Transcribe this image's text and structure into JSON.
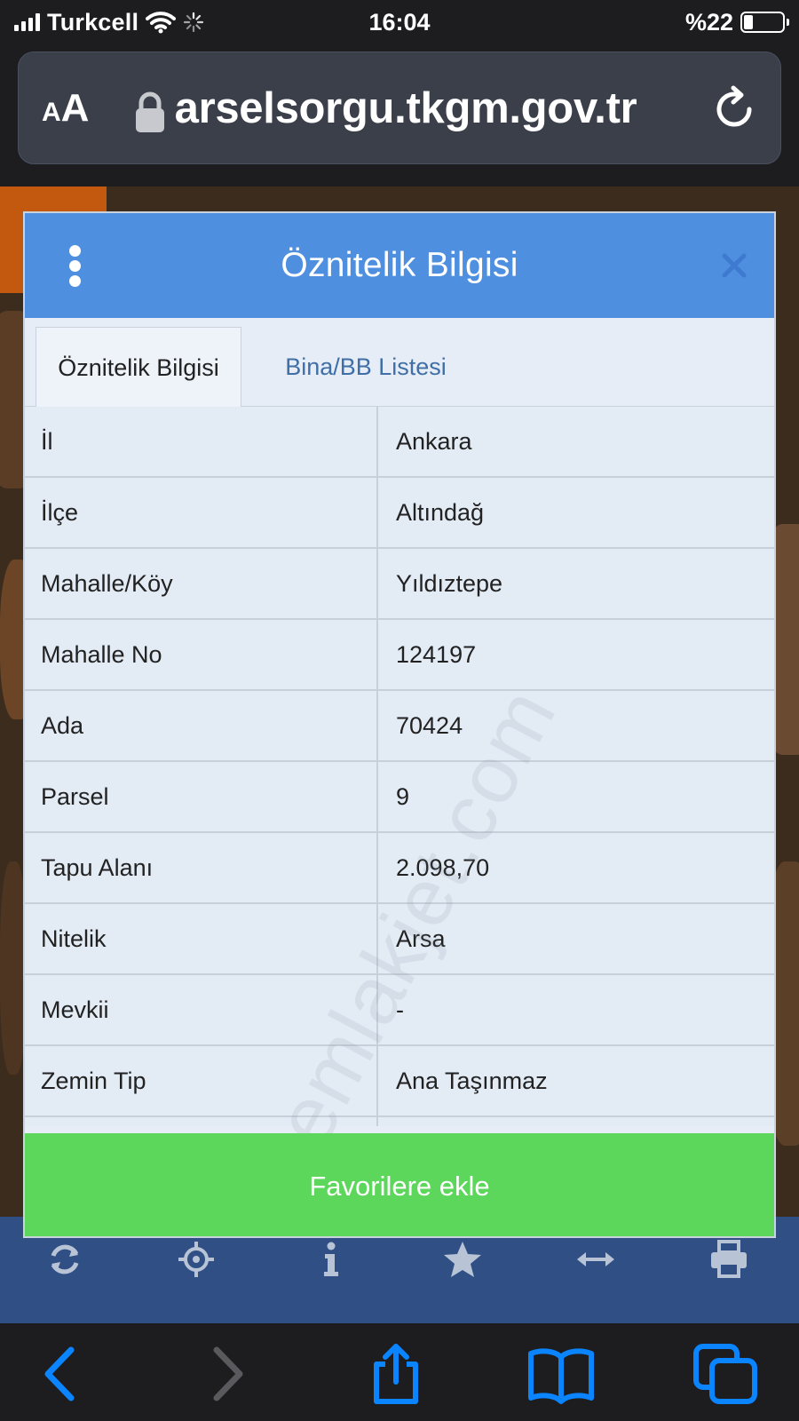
{
  "status_bar": {
    "carrier": "Turkcell",
    "time": "16:04",
    "battery_text": "%22",
    "battery_level": 0.22
  },
  "browser": {
    "aa_small": "A",
    "aa_big": "A",
    "url": "parselsorgu.tkgm.gov.tr"
  },
  "modal": {
    "title": "Öznitelik Bilgisi",
    "tabs": [
      {
        "label": "Öznitelik Bilgisi",
        "active": true
      },
      {
        "label": "Bina/BB Listesi",
        "active": false
      }
    ],
    "rows": [
      {
        "key": "İl",
        "value": "Ankara"
      },
      {
        "key": "İlçe",
        "value": "Altındağ"
      },
      {
        "key": "Mahalle/Köy",
        "value": "Yıldıztepe"
      },
      {
        "key": "Mahalle No",
        "value": "124197"
      },
      {
        "key": "Ada",
        "value": "70424"
      },
      {
        "key": "Parsel",
        "value": "9"
      },
      {
        "key": "Tapu Alanı",
        "value": "2.098,70"
      },
      {
        "key": "Nitelik",
        "value": "Arsa"
      },
      {
        "key": "Mevkii",
        "value": "-"
      },
      {
        "key": "Zemin Tip",
        "value": "Ana Taşınmaz"
      }
    ],
    "favorite_button": "Favorilere ekle",
    "watermark": "emlakjet.com"
  },
  "map_toolbar": {
    "icons": [
      "refresh-icon",
      "locate-icon",
      "info-icon",
      "star-icon",
      "resize-horizontal-icon",
      "print-icon"
    ]
  },
  "safari_toolbar": {
    "icons": [
      "back-icon",
      "forward-icon",
      "share-icon",
      "bookmarks-icon",
      "tabs-icon"
    ]
  },
  "colors": {
    "header_blue": "#4f8fe0",
    "favorite_green": "#5cd65b",
    "safari_blue": "#0a84ff",
    "map_toolbar": "#2f4f85"
  }
}
